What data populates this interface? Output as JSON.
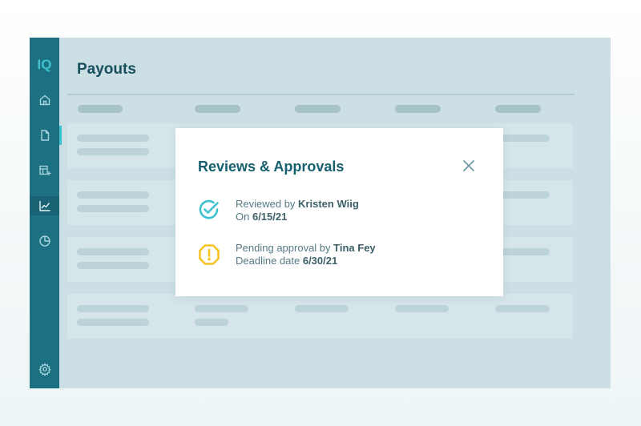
{
  "app": {
    "logo": "IQ"
  },
  "sidebar": {
    "items": [
      {
        "icon": "home-icon"
      },
      {
        "icon": "document-icon"
      },
      {
        "icon": "table-add-icon"
      },
      {
        "icon": "line-chart-icon"
      },
      {
        "icon": "pie-chart-icon"
      }
    ],
    "settings_icon": "gear-icon"
  },
  "page": {
    "title": "Payouts"
  },
  "modal": {
    "title": "Reviews & Approvals",
    "close_icon": "close-icon",
    "entries": [
      {
        "status": "reviewed",
        "icon": "check-circle-icon",
        "color": "#3ec2d0",
        "line1_prefix": "Reviewed by ",
        "line1_name": "Kristen Wiig",
        "line2_prefix": "On ",
        "line2_value": "6/15/21"
      },
      {
        "status": "pending",
        "icon": "warning-octagon-icon",
        "color": "#f5c326",
        "line1_prefix": "Pending approval by ",
        "line1_name": "Tina Fey",
        "line2_prefix": "Deadline date ",
        "line2_value": "6/30/21"
      }
    ]
  }
}
